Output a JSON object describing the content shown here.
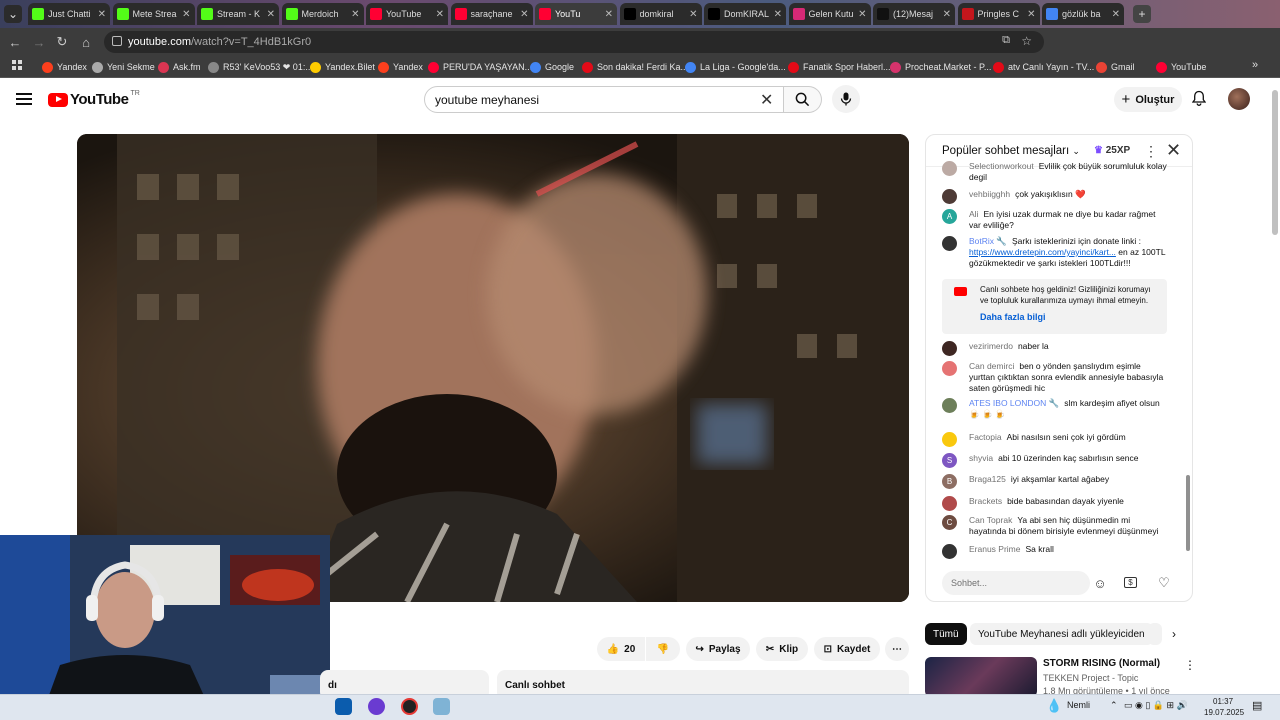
{
  "browser": {
    "tabs": [
      {
        "label": "Just Chatti",
        "icon": "kick-icon",
        "color": "#53fc18"
      },
      {
        "label": "Mete Strea",
        "icon": "kick-icon",
        "color": "#53fc18"
      },
      {
        "label": "Stream - K",
        "icon": "kick-icon",
        "color": "#53fc18"
      },
      {
        "label": "Merdoich",
        "icon": "kick-icon",
        "color": "#53fc18"
      },
      {
        "label": "YouTube",
        "icon": "youtube-icon",
        "color": "#ff0033"
      },
      {
        "label": "saraçhane",
        "icon": "youtube-icon",
        "color": "#ff0033"
      },
      {
        "label": "YouTu",
        "icon": "youtube-icon",
        "color": "#ff0033"
      },
      {
        "label": "domkiral",
        "icon": "x-icon",
        "color": "#000000"
      },
      {
        "label": "DomKIRAL",
        "icon": "x-icon",
        "color": "#000000"
      },
      {
        "label": "Gelen Kutu",
        "icon": "instagram-icon",
        "color": "#d62976"
      },
      {
        "label": "(12)Mesaj",
        "icon": "tiktok-icon",
        "color": "#111111"
      },
      {
        "label": "Pringles C",
        "icon": "pringles-icon",
        "color": "#c4161c"
      },
      {
        "label": "gözlük ba",
        "icon": "google-icon",
        "color": "#4285f4"
      }
    ],
    "new_tab": "+",
    "tab_close": "✕",
    "url_host": "youtube.com",
    "url_path": "/watch?v=T_4HdB1kGr0",
    "bookmarks": [
      {
        "label": "Yandex",
        "color": "#fc3f1d"
      },
      {
        "label": "Yeni Sekme",
        "color": "#aaaaaa"
      },
      {
        "label": "Ask.fm",
        "color": "#db3552"
      },
      {
        "label": "R53' KeVoo53 ❤ 01:...",
        "color": "#888888"
      },
      {
        "label": "Yandex.Bilet",
        "color": "#ffcc00"
      },
      {
        "label": "Yandex",
        "color": "#fc3f1d"
      },
      {
        "label": "PERU'DA YAŞAYAN...",
        "color": "#ff0033"
      },
      {
        "label": "Google",
        "color": "#4285f4"
      },
      {
        "label": "Son dakika! Ferdi Ka...",
        "color": "#e30a17"
      },
      {
        "label": "La Liga - Google'da...",
        "color": "#4285f4"
      },
      {
        "label": "Fanatik Spor Haberl...",
        "color": "#e30a17"
      },
      {
        "label": "Procheat.Market - P...",
        "color": "#d6336c"
      },
      {
        "label": "atv Canlı Yayın - TV...",
        "color": "#e30a17"
      },
      {
        "label": "Gmail",
        "color": "#ea4335"
      },
      {
        "label": "YouTube",
        "color": "#ff0033"
      }
    ]
  },
  "header": {
    "logo": "YouTube",
    "logo_country": "TR",
    "search_value": "youtube meyhanesi",
    "create_label": "Oluştur"
  },
  "chat": {
    "title": "Popüler sohbet mesajları",
    "xp": "25XP",
    "messages": [
      {
        "author": "Selectionworkout",
        "text": "Evlilik çok büyük sorumluluk kolay degil",
        "avatar": "",
        "color": "#bcaaa4"
      },
      {
        "author": "vehbiigghh",
        "text": "çok yakışıklısın ❤️",
        "avatar": "",
        "color": "#4e3b36"
      },
      {
        "author": "Ali",
        "text": "En iyisi uzak durmak ne diye bu kadar rağmet var evliliğe?",
        "avatar": "A",
        "color": "#26a69a"
      },
      {
        "author": "BotRix 🔧",
        "text": "Şarkı isteklerinizi için donate linki :",
        "link": "https://www.dretepin.com/yayinci/kart...",
        "text2": "en az 100TL gözükmektedir ve şarkı istekleri 100TLdir!!!",
        "avatar": "",
        "color": "#333333"
      },
      {
        "author": "vezirimerdo",
        "text": "naber la",
        "avatar": "",
        "color": "#3e2723"
      },
      {
        "author": "Can demirci",
        "text": "ben o yönden şanslıydım eşimle yurttan çıktıktan sonra evlendik annesiyle babasıyla saten görüşmedi hic",
        "avatar": "",
        "color": "#e57373"
      },
      {
        "author": "ATES IBO LONDON 🔧",
        "text": "slm kardeşim afiyet olsun",
        "text2": "🍺 🍺 🍺",
        "avatar": "",
        "color": "#6d7f5a"
      },
      {
        "author": "Factopia",
        "text": "Abi nasılsın seni çok iyi gördüm",
        "avatar": "",
        "color": "#f9c80e"
      },
      {
        "author": "shyvia",
        "text": "abi 10 üzerinden kaç sabırlısın sence",
        "avatar": "S",
        "color": "#7e57c2"
      },
      {
        "author": "Braga125",
        "text": "iyi akşamlar kartal ağabey",
        "avatar": "B",
        "color": "#8d6e63"
      },
      {
        "author": "Brackets",
        "text": "bide babasından dayak yiyenle",
        "avatar": "",
        "color": "#b04a4a"
      },
      {
        "author": "Can Toprak",
        "text": "Ya abi sen hiç düşünmedin mi hayatında bi dönem birisiyle evlenmeyi düşünmeyi",
        "avatar": "C",
        "color": "#6d4c41"
      },
      {
        "author": "Eranus Prime",
        "text": "Sa krall",
        "avatar": "",
        "color": "#333333"
      }
    ],
    "welcome_text": "Canlı sohbete hoş geldiniz! Gizliliğinizi korumayı ve topluluk kurallarımıza uymayı ihmal etmeyin.",
    "welcome_link": "Daha fazla bilgi",
    "input_placeholder": "Sohbet..."
  },
  "actions": {
    "like_count": "20",
    "share": "Paylaş",
    "clip": "Klip",
    "save": "Kaydet"
  },
  "below": {
    "left_label": "dı",
    "right_label": "Canlı sohbet"
  },
  "recs": {
    "chips": [
      "Tümü",
      "YouTube Meyhanesi adlı yükleyiciden"
    ],
    "title": "STORM RISING (Normal)",
    "channel": "TEKKEN Project - Topic",
    "meta": "1,8 Mn görüntüleme • 1 yıl önce"
  },
  "taskbar": {
    "weather": "Nemli",
    "time": "01:37",
    "date": "19.07.2025"
  },
  "colors": {
    "youtube_red": "#ff0000",
    "link_blue": "#065fd4",
    "moderator_blue": "#5e84f1"
  }
}
